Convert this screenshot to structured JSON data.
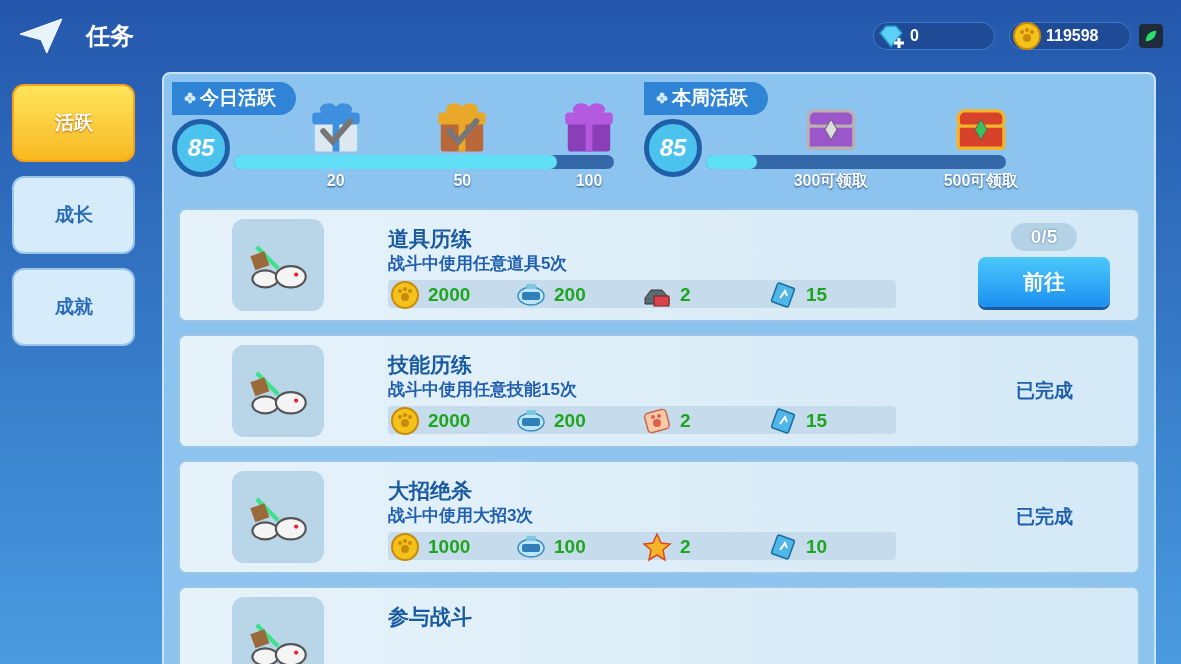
{
  "header": {
    "title": "任务"
  },
  "currencies": [
    {
      "kind": "diamond",
      "amount": "0"
    },
    {
      "kind": "coin",
      "amount": "119598"
    }
  ],
  "sidebar": {
    "items": [
      {
        "label": "活跃",
        "selected": true
      },
      {
        "label": "成长",
        "selected": false
      },
      {
        "label": "成就",
        "selected": false
      }
    ]
  },
  "daily": {
    "title": "今日活跃",
    "points": "85",
    "level": 0.85,
    "rewards": [
      {
        "kind": "blue-gift",
        "label": "20",
        "claimed": true
      },
      {
        "kind": "gold-gift",
        "label": "50",
        "claimed": true
      },
      {
        "kind": "purple-gift",
        "label": "100",
        "claimed": false
      }
    ]
  },
  "weekly": {
    "title": "本周活跃",
    "points": "85",
    "level": 0.17,
    "rewards": [
      {
        "kind": "purple-chest",
        "label": "300可领取",
        "claimed": false
      },
      {
        "kind": "red-chest",
        "label": "500可领取",
        "claimed": false
      }
    ]
  },
  "tasks": [
    {
      "title": "道具历练",
      "description": "战斗中使用任意道具5次",
      "rewards": [
        {
          "kind": "coin",
          "amount": "2000"
        },
        {
          "kind": "exp",
          "amount": "200"
        },
        {
          "kind": "car",
          "amount": "2"
        },
        {
          "kind": "ticket",
          "amount": "15"
        }
      ],
      "kind": "in-progress",
      "progress": "0/5",
      "action": "前往"
    },
    {
      "title": "技能历练",
      "description": "战斗中使用任意技能15次",
      "rewards": [
        {
          "kind": "coin",
          "amount": "2000"
        },
        {
          "kind": "exp",
          "amount": "200"
        },
        {
          "kind": "paw",
          "amount": "2"
        },
        {
          "kind": "ticket",
          "amount": "15"
        }
      ],
      "kind": "done",
      "status": "已完成"
    },
    {
      "title": "大招绝杀",
      "description": "战斗中使用大招3次",
      "rewards": [
        {
          "kind": "coin",
          "amount": "1000"
        },
        {
          "kind": "exp",
          "amount": "100"
        },
        {
          "kind": "star",
          "amount": "2"
        },
        {
          "kind": "ticket",
          "amount": "10"
        }
      ],
      "kind": "done",
      "status": "已完成"
    },
    {
      "title": "参与战斗"
    }
  ]
}
